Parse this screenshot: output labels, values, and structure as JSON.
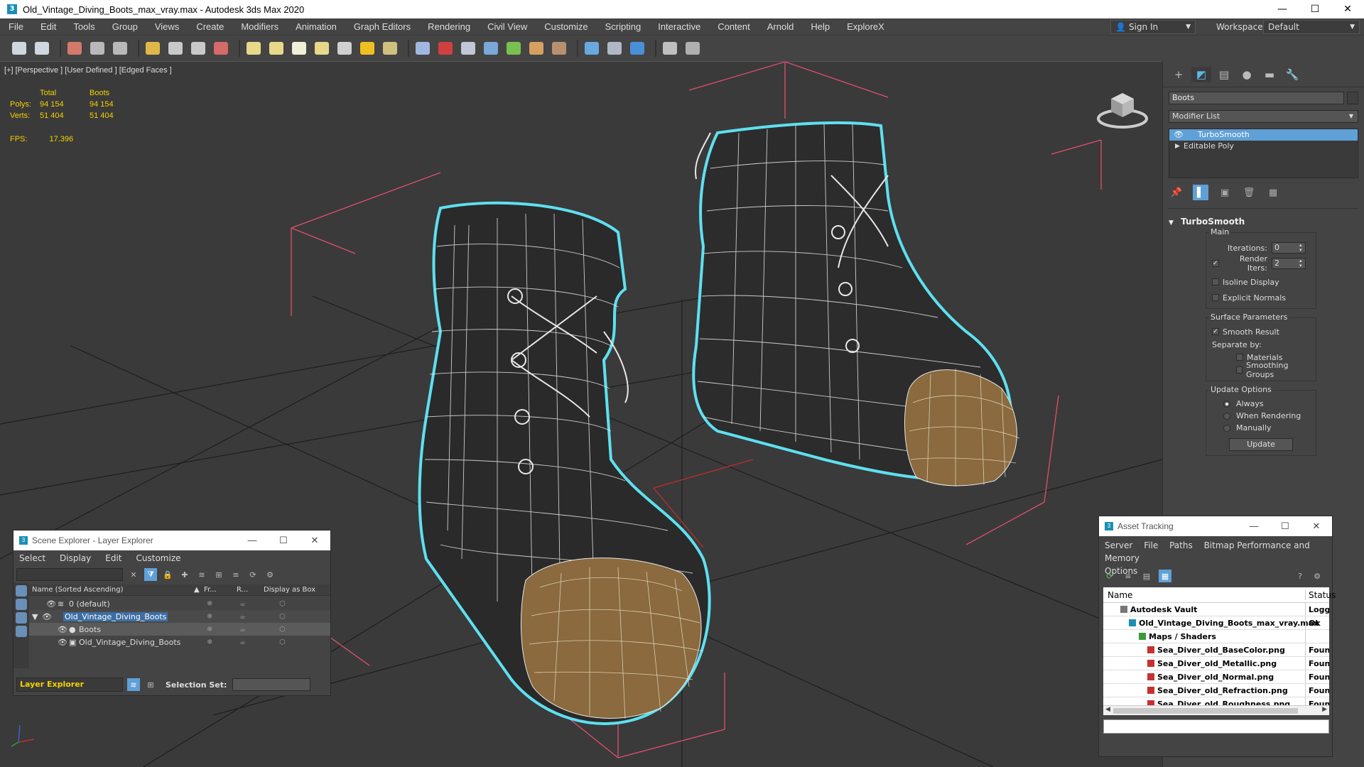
{
  "window": {
    "title": "Old_Vintage_Diving_Boots_max_vray.max - Autodesk 3ds Max 2020",
    "app_icon": "3ds-max-icon",
    "controls": [
      "—",
      "☐",
      "✕"
    ]
  },
  "menu": {
    "items": [
      "File",
      "Edit",
      "Tools",
      "Group",
      "Views",
      "Create",
      "Modifiers",
      "Animation",
      "Graph Editors",
      "Rendering",
      "Civil View",
      "Customize",
      "Scripting",
      "Interactive",
      "Content",
      "Arnold",
      "Help",
      "ExploreX"
    ],
    "sign_in": "Sign In",
    "workspaces_label": "Workspaces:",
    "workspace_value": "Default"
  },
  "toolbar": {
    "icons": [
      {
        "name": "undo-scene-icon",
        "color": "#cfd8e0"
      },
      {
        "name": "redo-scene-icon",
        "color": "#cfd8e0"
      },
      {
        "name": "render-frame-icon",
        "color": "#d47a6a"
      },
      {
        "name": "grid-icon",
        "color": "#b9b9b9"
      },
      {
        "name": "table-icon",
        "color": "#b9b9b9"
      },
      {
        "name": "light-bulb-icon",
        "color": "#e0b84a"
      },
      {
        "name": "teapot-icon",
        "color": "#c9c9c9"
      },
      {
        "name": "sphere-sweep-icon",
        "color": "#c9c9c9"
      },
      {
        "name": "material-icon",
        "color": "#d46a6a"
      },
      {
        "name": "box-icon",
        "color": "#e8d88a"
      },
      {
        "name": "dome-icon",
        "color": "#e8d88a"
      },
      {
        "name": "sphere-icon",
        "color": "#f0f0d8"
      },
      {
        "name": "teapot-solid-icon",
        "color": "#e8d88a"
      },
      {
        "name": "cone-icon",
        "color": "#d0d0d0"
      },
      {
        "name": "sun-icon",
        "color": "#f0c020"
      },
      {
        "name": "light-sphere-icon",
        "color": "#d0c080"
      },
      {
        "name": "particle-icon",
        "color": "#a0b8e0"
      },
      {
        "name": "hair-icon",
        "color": "#d04040"
      },
      {
        "name": "camera-icon",
        "color": "#c0c8d8"
      },
      {
        "name": "gear-render-icon",
        "color": "#7aa8d8"
      },
      {
        "name": "plant-icon",
        "color": "#7ac050"
      },
      {
        "name": "hdr-icon",
        "color": "#d8a060"
      },
      {
        "name": "texture-icon",
        "color": "#b89070"
      },
      {
        "name": "globe-icon",
        "color": "#6aa8e0"
      },
      {
        "name": "render-setup-icon",
        "color": "#b0b8c8"
      },
      {
        "name": "render-teapot-icon",
        "color": "#4a90d8"
      },
      {
        "name": "script-icon",
        "color": "#c0c0c0"
      },
      {
        "name": "help-icon",
        "color": "#b0b0b0"
      }
    ]
  },
  "viewport": {
    "label": "[+] [Perspective ] [User Defined ] [Edged Faces ]",
    "stats": {
      "headers": [
        "",
        "Total",
        "Boots"
      ],
      "rows": [
        [
          "Polys:",
          "94 154",
          "94 154"
        ],
        [
          "Verts:",
          "51 404",
          "51 404"
        ]
      ],
      "fps_label": "FPS:",
      "fps_value": "17.396"
    }
  },
  "command_panel": {
    "tabs": [
      "+",
      "◩",
      "▤",
      "●",
      "▬",
      "🔧"
    ],
    "object_name": "Boots",
    "modifier_list": "Modifier List",
    "stack": [
      {
        "label": "TurboSmooth",
        "selected": true
      },
      {
        "label": "Editable Poly",
        "selected": false
      }
    ],
    "stack_tools": [
      "📌",
      "▌",
      "▣",
      "🗑",
      "▦"
    ],
    "rollout_title": "TurboSmooth",
    "main_group": "Main",
    "iterations_label": "Iterations:",
    "iterations_value": "0",
    "render_iters_label": "Render Iters:",
    "render_iters_value": "2",
    "isoline": "Isoline Display",
    "explicit_normals": "Explicit Normals",
    "surface_group": "Surface Parameters",
    "smooth_result": "Smooth Result",
    "separate_by": "Separate by:",
    "materials": "Materials",
    "smoothing_groups": "Smoothing Groups",
    "update_group": "Update Options",
    "always": "Always",
    "when_rendering": "When Rendering",
    "manually": "Manually",
    "update_btn": "Update"
  },
  "scene_explorer": {
    "title": "Scene Explorer - Layer Explorer",
    "menu": [
      "Select",
      "Display",
      "Edit",
      "Customize"
    ],
    "col_name": "Name (Sorted Ascending)",
    "col_fr": "Fr...",
    "col_r": "R...",
    "col_box": "Display as Box",
    "sort_arrow": "▲",
    "rows": [
      {
        "name": "0 (default)",
        "indent": 0
      },
      {
        "name": "Old_Vintage_Diving_Boots",
        "indent": 0
      },
      {
        "name": "Boots",
        "indent": 1
      },
      {
        "name": "Old_Vintage_Diving_Boots",
        "indent": 1
      }
    ],
    "layer_explorer": "Layer Explorer",
    "selection_set": "Selection Set:"
  },
  "asset_tracking": {
    "title": "Asset Tracking",
    "menu": [
      "Server",
      "File",
      "Paths",
      "Bitmap Performance and Memory",
      "Options"
    ],
    "col_name": "Name",
    "col_status": "Status",
    "rows": [
      {
        "name": "Autodesk Vault",
        "status": "Logged",
        "icon": "vault-icon",
        "icon_color": "#777"
      },
      {
        "name": "Old_Vintage_Diving_Boots_max_vray.max",
        "status": "Ok",
        "icon": "max-file-icon",
        "icon_color": "#1a8fb5"
      },
      {
        "name": "Maps / Shaders",
        "status": "",
        "icon": "maps-icon",
        "icon_color": "#3a9a3a"
      },
      {
        "name": "Sea_Diver_old_BaseColor.png",
        "status": "Found",
        "icon": "png-icon",
        "icon_color": "#c83030"
      },
      {
        "name": "Sea_Diver_old_Metallic.png",
        "status": "Found",
        "icon": "png-icon",
        "icon_color": "#c83030"
      },
      {
        "name": "Sea_Diver_old_Normal.png",
        "status": "Found",
        "icon": "png-icon",
        "icon_color": "#c83030"
      },
      {
        "name": "Sea_Diver_old_Refraction.png",
        "status": "Found",
        "icon": "png-icon",
        "icon_color": "#c83030"
      },
      {
        "name": "Sea_Diver_old_Roughness.png",
        "status": "Found",
        "icon": "png-icon",
        "icon_color": "#c83030"
      }
    ]
  },
  "colors": {
    "selection_outline": "#5ee0f0",
    "bounding_box": "#e04f6f",
    "stats_text": "#f4d200",
    "accent_blue": "#5fa0d6"
  }
}
